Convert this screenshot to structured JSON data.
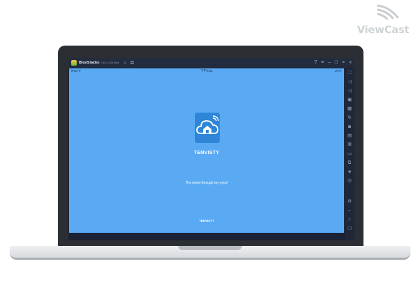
{
  "watermark": {
    "text": "ViewCast"
  },
  "titlebar": {
    "app_name": "BlueStacks",
    "version": "4.60.1.1008 Beta",
    "icons": [
      "home-icon",
      "multi-instance-icon",
      "help-icon",
      "menu-icon",
      "minimize-icon",
      "maximize-icon",
      "close-icon",
      "collapse-sidebar-icon"
    ]
  },
  "statusbar": {
    "left": "iPad ᯤ",
    "center": "下午6:01",
    "right": "27%"
  },
  "app": {
    "name": "TENVISTY",
    "tagline": "The world through my eyes!",
    "footer": "TENVISTY"
  },
  "sidebar": {
    "icons": [
      "fullscreen-icon",
      "volume-up-icon",
      "volume-down-icon",
      "video-icon",
      "keyboard-icon",
      "rotate-icon",
      "camera-icon",
      "screenshot-icon",
      "multi-window-icon",
      "folder-icon",
      "copy-icon",
      "layers-icon",
      "location-icon",
      "settings-icon",
      "back-icon",
      "home-icon",
      "recents-icon"
    ]
  }
}
